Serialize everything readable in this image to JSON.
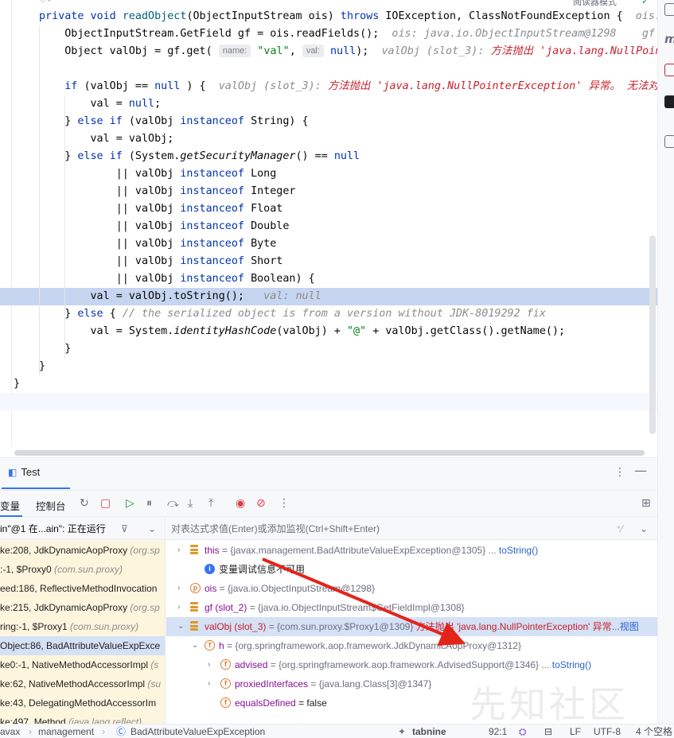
{
  "editor": {
    "reader_mode": "阅读器模式",
    "lines": [
      [
        [
          "kw",
          "private "
        ],
        [
          "kw",
          "void "
        ],
        [
          "fn",
          "readObject"
        ],
        [
          "",
          "(ObjectInputStream ois) "
        ],
        [
          "kw",
          "throws "
        ],
        [
          "",
          "IOException, ClassNotFoundException {  "
        ],
        [
          "hint",
          "ois:"
        ]
      ],
      [
        [
          "",
          "    ObjectInputStream.GetField gf = ois.readFields();  "
        ],
        [
          "hint",
          "ois: java.io.ObjectInputStream@1298    gf"
        ]
      ],
      [
        [
          "",
          "    Object valObj = gf.get( "
        ],
        [
          "chip",
          "name:"
        ],
        [
          "str",
          " \"val\""
        ],
        [
          "",
          ", "
        ],
        [
          "chip",
          "val:"
        ],
        [
          "kw",
          " null"
        ],
        [
          "",
          ");  "
        ],
        [
          "hint",
          "valObj (slot_3): "
        ],
        [
          "err",
          "方法抛出 'java.lang.NullPoint"
        ]
      ],
      [
        [
          "",
          ""
        ]
      ],
      [
        [
          "",
          "    "
        ],
        [
          "kw",
          "if "
        ],
        [
          "",
          "(valObj == "
        ],
        [
          "kw",
          "null"
        ],
        [
          "",
          " ) {  "
        ],
        [
          "hint",
          "valObj (slot_3): "
        ],
        [
          "err",
          "方法抛出 'java.lang.NullPointerException' 异常。 无法对"
        ]
      ],
      [
        [
          "",
          "        val = "
        ],
        [
          "kw",
          "null"
        ],
        [
          "",
          ";"
        ]
      ],
      [
        [
          "",
          "    } "
        ],
        [
          "kw",
          "else if "
        ],
        [
          "",
          "(valObj "
        ],
        [
          "kw",
          "instanceof "
        ],
        [
          "",
          "String) {"
        ]
      ],
      [
        [
          "",
          "        val = valObj;"
        ]
      ],
      [
        [
          "",
          "    } "
        ],
        [
          "kw",
          "else if "
        ],
        [
          "",
          "(System."
        ],
        [
          "it",
          "getSecurityManager"
        ],
        [
          "",
          "() == "
        ],
        [
          "kw",
          "null"
        ]
      ],
      [
        [
          "",
          "            || valObj "
        ],
        [
          "kw",
          "instanceof "
        ],
        [
          "",
          "Long"
        ]
      ],
      [
        [
          "",
          "            || valObj "
        ],
        [
          "kw",
          "instanceof "
        ],
        [
          "",
          "Integer"
        ]
      ],
      [
        [
          "",
          "            || valObj "
        ],
        [
          "kw",
          "instanceof "
        ],
        [
          "",
          "Float"
        ]
      ],
      [
        [
          "",
          "            || valObj "
        ],
        [
          "kw",
          "instanceof "
        ],
        [
          "",
          "Double"
        ]
      ],
      [
        [
          "",
          "            || valObj "
        ],
        [
          "kw",
          "instanceof "
        ],
        [
          "",
          "Byte"
        ]
      ],
      [
        [
          "",
          "            || valObj "
        ],
        [
          "kw",
          "instanceof "
        ],
        [
          "",
          "Short"
        ]
      ],
      [
        [
          "",
          "            || valObj "
        ],
        [
          "kw",
          "instanceof "
        ],
        [
          "",
          "Boolean) {"
        ]
      ],
      [
        [
          "",
          "        val = valObj.toString();  "
        ],
        [
          "hint",
          " val: null"
        ]
      ],
      [
        [
          "",
          "    } "
        ],
        [
          "kw",
          "else "
        ],
        [
          "",
          "{ "
        ],
        [
          "cmt",
          "// the serialized object is from a version without JDK-8019292 fix"
        ]
      ],
      [
        [
          "",
          "        val = System."
        ],
        [
          "it",
          "identityHashCode"
        ],
        [
          "",
          "(valObj) + "
        ],
        [
          "str",
          "\"@\""
        ],
        [
          "",
          " + valObj.getClass().getName();"
        ]
      ],
      [
        [
          "",
          "    }"
        ]
      ],
      [
        [
          "",
          "}"
        ]
      ],
      [
        [
          "",
          "}"
        ]
      ],
      [
        [
          "",
          ""
        ]
      ]
    ]
  },
  "debug": {
    "tab_label": "Test",
    "toolbar": {
      "variables_tab": "变量",
      "console_tab": "控制台"
    },
    "thread_label": "in\"@1 在...ain\": 正在运行",
    "eval_placeholder": "对表达式求值(Enter)或添加监视(Ctrl+Shift+Enter)",
    "frames": [
      {
        "method": "ke:208, JdkDynamicAopProxy ",
        "cls": "(org.sp"
      },
      {
        "method": ":-1, $Proxy0 ",
        "cls": "(com.sun.proxy)"
      },
      {
        "method": "eed:186, ReflectiveMethodInvocation",
        "cls": ""
      },
      {
        "method": "ke:215, JdkDynamicAopProxy ",
        "cls": "(org.sp"
      },
      {
        "method": "ring:-1, $Proxy1 ",
        "cls": "(com.sun.proxy)"
      },
      {
        "method": "Object:86, BadAttributeValueExpExce",
        "cls": ""
      },
      {
        "method": "ke0:-1, NativeMethodAccessorImpl ",
        "cls": "(s"
      },
      {
        "method": "ke:62, NativeMethodAccessorImpl ",
        "cls": "(su"
      },
      {
        "method": "ke:43, DelegatingMethodAccessorIm",
        "cls": ""
      },
      {
        "method": "ke:497, Method ",
        "cls": "(java.lang.reflect)"
      }
    ],
    "variables": [
      {
        "name": "this",
        "value": " = {javax.management.BadAttributeValueExpException@1305} ... ",
        "link": "toString()",
        "err": ""
      },
      {
        "name": "",
        "value": "变量调试信息不可用",
        "link": "",
        "err": ""
      },
      {
        "name": "ois",
        "value": " = {java.io.ObjectInputStream@1298}",
        "link": "",
        "err": ""
      },
      {
        "name": "gf (slot_2)",
        "value": " = {java.io.ObjectInputStream$GetFieldImpl@1308}",
        "link": "",
        "err": ""
      },
      {
        "name": "valObj (slot_3)",
        "value": " = {com.sun.proxy.$Proxy1@1309} ",
        "link": "...视图",
        "err": "方法抛出 'java.lang.NullPointerException' 异常"
      },
      {
        "name": "h",
        "value": " = {org.springframework.aop.framework.JdkDynamicAopProxy@1312}",
        "link": "",
        "err": ""
      },
      {
        "name": "advised",
        "value": " = {org.springframework.aop.framework.AdvisedSupport@1346} ... ",
        "link": "toString()",
        "err": ""
      },
      {
        "name": "proxiedInterfaces",
        "value": " = {java.lang.Class[3]@1347}",
        "link": "",
        "err": ""
      },
      {
        "name": "equalsDefined",
        "value": " = false",
        "link": "",
        "err": ""
      }
    ]
  },
  "status": {
    "breadcrumb": [
      "avax",
      "management",
      "BadAttributeValueExpException"
    ],
    "tabnine": "tabnine",
    "position": "92:1",
    "line_sep": "LF",
    "encoding": "UTF-8",
    "indent": "4 个空格"
  },
  "watermark": "先知社区",
  "colors": {
    "keyword": "#0033b3",
    "string": "#067d17",
    "error": "#c7222d",
    "selection": "#c6d5f0",
    "accent": "#3574f0"
  }
}
